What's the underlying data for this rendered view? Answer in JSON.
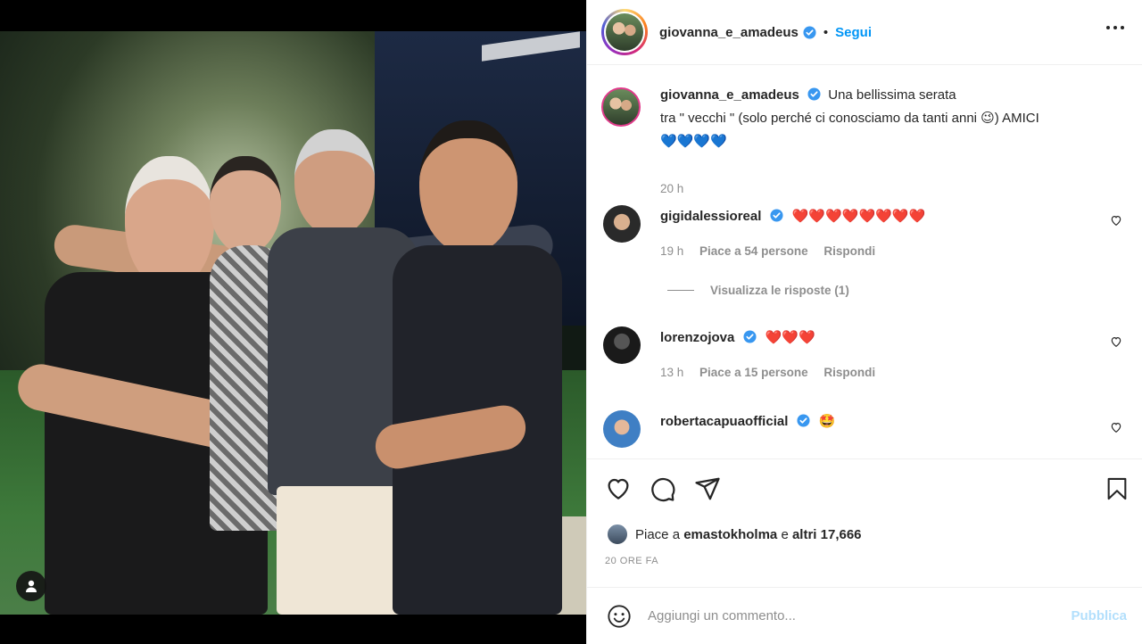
{
  "post": {
    "author": "giovanna_e_amadeus",
    "follow_label": "Segui",
    "separator": "•"
  },
  "caption": {
    "username": "giovanna_e_amadeus",
    "text_line1": "Una bellissima serata",
    "text_line2": "tra \" vecchi \" (solo perché ci conosciamo da tanti anni 😉) AMICI",
    "text_line3": "💙💙💙💙",
    "time": "20 h"
  },
  "comments": [
    {
      "username": "gigidalessioreal",
      "text": "❤️❤️❤️❤️❤️❤️❤️❤️",
      "time": "19 h",
      "likes": "Piace a 54 persone",
      "reply": "Rispondi",
      "view_replies": "Visualizza le risposte (1)"
    },
    {
      "username": "lorenzojova",
      "text": "❤️❤️❤️",
      "time": "13 h",
      "likes": "Piace a 15 persone",
      "reply": "Rispondi"
    },
    {
      "username": "robertacapuaofficial",
      "text": "🤩"
    }
  ],
  "engagement": {
    "likes_prefix": "Piace a",
    "liker": "emastokholma",
    "likes_conj": "e",
    "likes_others": "altri 17,666",
    "date": "20 ORE FA"
  },
  "add_comment": {
    "placeholder": "Aggiungi un commento...",
    "publish": "Pubblica"
  },
  "colors": {
    "accent": "#0095f6",
    "publish_disabled": "#b2dffc",
    "muted": "#8e8e8e",
    "verified": "#3897f0"
  },
  "icons": [
    "heart-icon",
    "comment-icon",
    "share-icon",
    "bookmark-icon",
    "more-icon",
    "emoji-icon",
    "verified-icon",
    "user-tag-icon"
  ]
}
